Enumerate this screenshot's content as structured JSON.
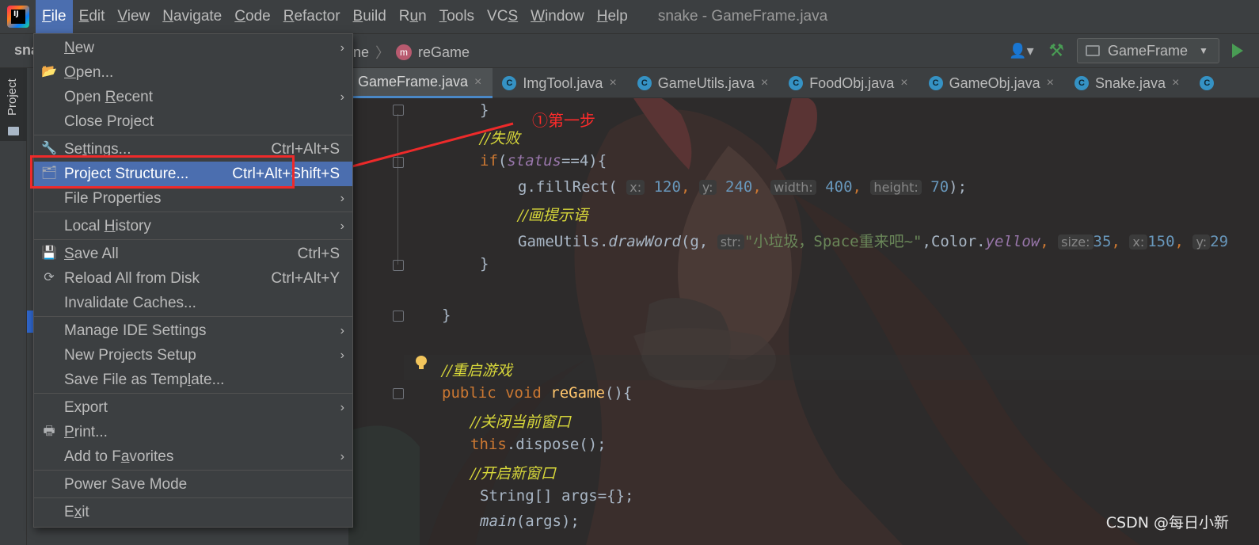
{
  "menubar": {
    "logo_text": "IJ",
    "items": [
      "File",
      "Edit",
      "View",
      "Navigate",
      "Code",
      "Refactor",
      "Build",
      "Run",
      "Tools",
      "VCS",
      "Window",
      "Help"
    ],
    "window_title": "snake - GameFrame.java"
  },
  "navbar": {
    "project_name": "sna",
    "crumb_prefix": "ne",
    "method_badge": "m",
    "method": "reGame",
    "run_config": "GameFrame"
  },
  "toolstrip": {
    "project_label": "Project"
  },
  "tabs": [
    {
      "label": "GameFrame.java",
      "active": true
    },
    {
      "label": "ImgTool.java"
    },
    {
      "label": "GameUtils.java"
    },
    {
      "label": "FoodObj.java"
    },
    {
      "label": "GameObj.java"
    },
    {
      "label": "Snake.java"
    }
  ],
  "tab_icon_letter": "C",
  "tab_close": "×",
  "annotation": {
    "step_text": "①第一步"
  },
  "code": {
    "l1": "}",
    "l2": "//失败",
    "l3_kw": "if",
    "l3_fld": "status",
    "l3_rest": "==4){",
    "l4_call": "g.fillRect(",
    "l4_h1": "x:",
    "l4_v1": "120",
    "l4_h2": "y:",
    "l4_v2": "240",
    "l4_h3": "width:",
    "l4_v3": "400",
    "l4_h4": "height:",
    "l4_v4": "70",
    "l4_end": ");",
    "l5": "//画提示语",
    "l6_cls": "GameUtils.",
    "l6_fn": "drawWord",
    "l6_arg": "(g,",
    "l6_h1": "str:",
    "l6_str": "\"小垃圾，Space重来吧~\"",
    "l6_color": ",Color.",
    "l6_yellow": "yellow",
    "l6_h2": "size:",
    "l6_v2": "35",
    "l6_h3": "x:",
    "l6_v3": "150",
    "l6_h4": "y:",
    "l6_v4": "29",
    "l7": "}",
    "l8": "}",
    "l9": "//重启游戏",
    "l10_kw": "public void",
    "l10_fn": "reGame",
    "l10_rest": "(){",
    "l11": "//关闭当前窗口",
    "l12_kw": "this",
    "l12_rest": ".dispose();",
    "l13": "//开启新窗口",
    "l14": "String[] args={};",
    "l15_fn": "main",
    "l15_rest": "(args);"
  },
  "file_menu": {
    "new": "New",
    "open": "Open...",
    "open_recent": "Open Recent",
    "close_project": "Close Project",
    "settings": "Settings...",
    "settings_sc": "Ctrl+Alt+S",
    "project_structure": "Project Structure...",
    "project_structure_sc": "Ctrl+Alt+Shift+S",
    "file_properties": "File Properties",
    "local_history": "Local History",
    "save_all": "Save All",
    "save_all_sc": "Ctrl+S",
    "reload": "Reload All from Disk",
    "reload_sc": "Ctrl+Alt+Y",
    "invalidate": "Invalidate Caches...",
    "manage_ide": "Manage IDE Settings",
    "new_projects_setup": "New Projects Setup",
    "save_template": "Save File as Template...",
    "export": "Export",
    "print": "Print...",
    "add_favorites": "Add to Favorites",
    "power_save": "Power Save Mode",
    "exit": "Exit"
  },
  "watermark": "CSDN @每日小新",
  "colors": {
    "accent": "#4b6eaf",
    "annotation": "#ee2a2a",
    "keyword": "#cc7832",
    "comment": "#d8d83a"
  }
}
